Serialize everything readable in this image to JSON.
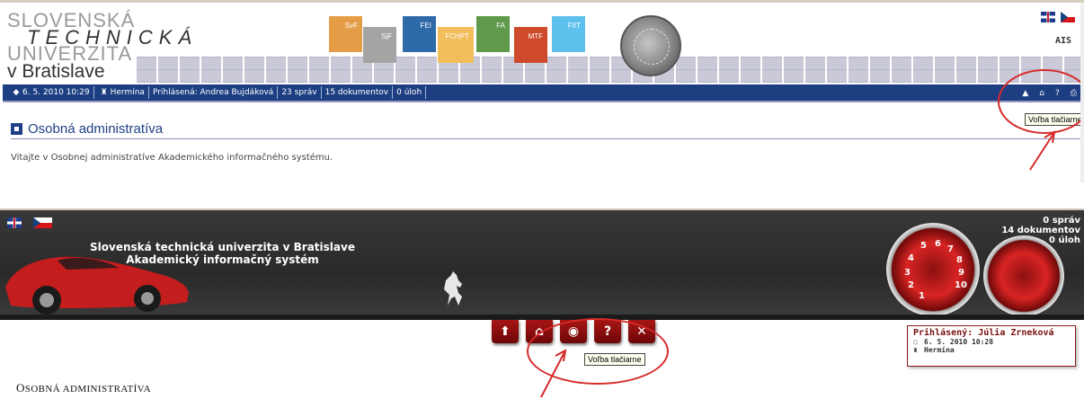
{
  "top": {
    "logo": {
      "line1": "SLOVENSKÁ",
      "line2": "TECHNICKÁ",
      "line3": "UNIVERZITA",
      "line4": "v Bratislave"
    },
    "faculties": [
      {
        "label": "SvF",
        "color": "#e49c46"
      },
      {
        "label": "SjF",
        "color": "#a4a4a4"
      },
      {
        "label": "FEI",
        "color": "#2f6aa8"
      },
      {
        "label": "FCHPT",
        "color": "#f2bd5b"
      },
      {
        "label": "FA",
        "color": "#5f9a4a"
      },
      {
        "label": "MTF",
        "color": "#cf4a2a"
      },
      {
        "label": "FIIT",
        "color": "#5ec0ec"
      }
    ],
    "system_label": "AIS",
    "infobar": {
      "datetime": "6. 5. 2010 10:29",
      "location": "Hermína",
      "user": "Prihlásená: Andrea Bujdáková",
      "messages": "23 správ",
      "documents": "15 dokumentov",
      "tasks": "0 úloh"
    },
    "section_title": "Osobná administratíva",
    "welcome": "Vitajte v Osobnej administratíve Akademického informačného systému.",
    "tooltip": "Voľba tlačiarne"
  },
  "bottom": {
    "title_line1": "Slovenská technická univerzita v Bratislave",
    "title_line2": "Akademický informačný systém",
    "counters": {
      "messages": "0 správ",
      "documents": "14 dokumentov",
      "tasks": "0 úloh"
    },
    "gauge_numbers": [
      "6",
      "7",
      "8",
      "9",
      "10",
      "5",
      "4",
      "3",
      "2",
      "1"
    ],
    "nav_buttons": [
      {
        "name": "up",
        "glyph": "⬆"
      },
      {
        "name": "home",
        "glyph": "⌂"
      },
      {
        "name": "printer",
        "glyph": "◉"
      },
      {
        "name": "help",
        "glyph": "?"
      },
      {
        "name": "close",
        "glyph": "✕"
      }
    ],
    "tooltip": "Voľba tlačiarne",
    "user": {
      "label": "Prihlásený: Júlia Zrneková",
      "datetime": "6. 5. 2010 10:28",
      "location": "Hermína"
    },
    "section_first": "O",
    "section_rest": "SOBNÁ ADMINISTRATÍVA"
  },
  "colors": {
    "accent_blue": "#1d3f82",
    "accent_red": "#a81515",
    "annotation": "#d62a2a"
  }
}
